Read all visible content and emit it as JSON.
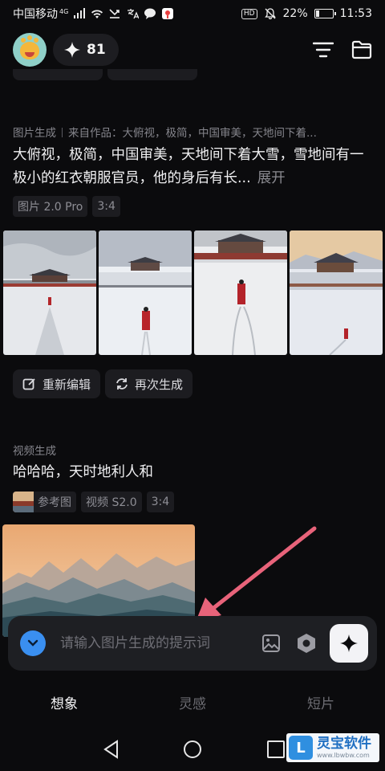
{
  "status_bar": {
    "carrier": "中国移动",
    "signal": "4G",
    "hd": "HD",
    "battery_percent": "22%",
    "battery_level": 0.22,
    "time": "11:53"
  },
  "header": {
    "credits": "81"
  },
  "post1": {
    "type_label": "图片生成",
    "source": "来自作品：大俯视，极简，中国审美，天地间下着...",
    "prompt": "大俯视，极简，中国审美，天地间下着大雪，雪地间有一极小的红衣朝服官员，他的身后有长...",
    "more": "展开",
    "tags": [
      "图片 2.0 Pro",
      "3:4"
    ],
    "actions": {
      "edit": "重新编辑",
      "regenerate": "再次生成"
    }
  },
  "post2": {
    "type_label": "视频生成",
    "prompt": "哈哈哈，天时地利人和",
    "tags": [
      "参考图",
      "视频 S2.0",
      "3:4"
    ]
  },
  "input": {
    "placeholder": "请输入图片生成的提示词"
  },
  "tabs": [
    "想象",
    "灵感",
    "短片"
  ],
  "watermark": {
    "title": "灵宝软件",
    "url": "www.lbwbw.com"
  },
  "colors": {
    "background": "#0b0b0d",
    "card": "#1c1c20",
    "accent_blue": "#3a8ff0",
    "pointer_red": "#e8637a"
  }
}
